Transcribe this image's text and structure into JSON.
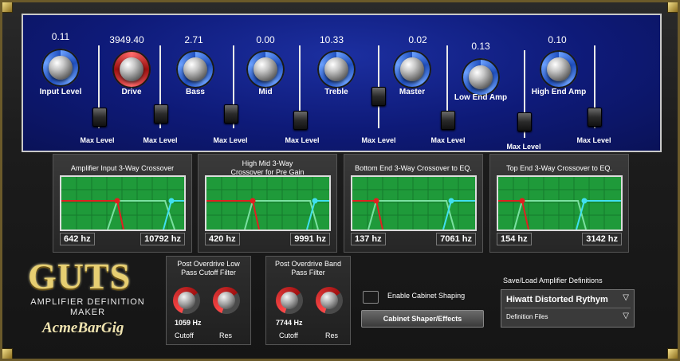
{
  "knobs": [
    {
      "value": "0.11",
      "label": "Input Level"
    },
    {
      "value": "3949.40",
      "label": "Drive"
    },
    {
      "value": "2.71",
      "label": "Bass"
    },
    {
      "value": "0.00",
      "label": "Mid"
    },
    {
      "value": "10.33",
      "label": "Treble"
    },
    {
      "value": "0.02",
      "label": "Master"
    },
    {
      "value": "0.13",
      "label": "Low End Amp"
    },
    {
      "value": "0.10",
      "label": "High End Amp"
    }
  ],
  "faders": [
    {
      "label": "Max Level"
    },
    {
      "label": "Max Level"
    },
    {
      "label": "Max Level"
    },
    {
      "label": "Max Level"
    },
    {
      "label": "Max Level"
    },
    {
      "label": "Max Level"
    },
    {
      "label": "Max Level"
    },
    {
      "label": "Max Level"
    }
  ],
  "crossovers": [
    {
      "title": "Amplifier Input 3-Way Crossover",
      "low_hz": "642 hz",
      "high_hz": "10792 hz"
    },
    {
      "title": "High Mid 3-Way\nCrossover  for Pre Gain",
      "low_hz": "420 hz",
      "high_hz": "9991 hz"
    },
    {
      "title": "Bottom End 3-Way Crossover to EQ.",
      "low_hz": "137 hz",
      "high_hz": "7061 hz"
    },
    {
      "title": "Top End 3-Way Crossover to EQ.",
      "low_hz": "154 hz",
      "high_hz": "3142 hz"
    }
  ],
  "logo": {
    "title": "GUTS",
    "subtitle": "AMPLIFIER DEFINITION MAKER",
    "brand": "AcmeBarGig"
  },
  "filters": [
    {
      "title": "Post Overdrive Low\nPass Cutoff Filter",
      "value": "1059 Hz",
      "cutoff_label": "Cutoff",
      "res_label": "Res"
    },
    {
      "title": "Post Overdrive Band\nPass Filter",
      "value": "7744 Hz",
      "cutoff_label": "Cutoff",
      "res_label": "Res"
    }
  ],
  "cabinet": {
    "enable_label": "Enable Cabinet Shaping",
    "button_label": "Cabinet Shaper/Effects"
  },
  "saveload": {
    "label": "Save/Load Amplifier Definitions",
    "selected": "Hiwatt Distorted Rythym",
    "files_label": "Definition Files",
    "arrow": "▽"
  },
  "colors": {
    "panel_blue": "#0e1a78",
    "graph_green": "#1f9a3a",
    "accent_red": "#e02020",
    "accent_cyan": "#40e0f0",
    "gold": "#e7cf72"
  }
}
